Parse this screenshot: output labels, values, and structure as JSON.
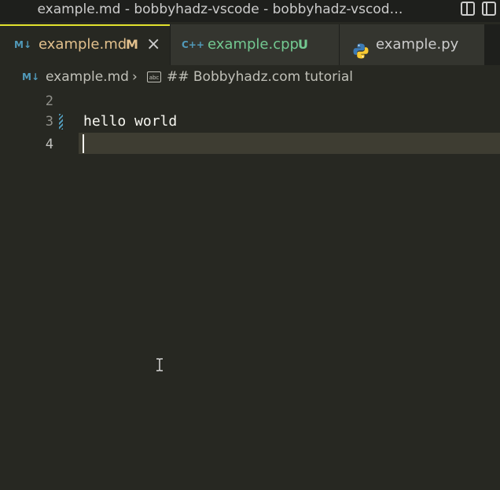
{
  "window": {
    "title": "example.md - bobbyhadz-vscode - bobbyhadz-vscod…"
  },
  "tabs": [
    {
      "icon_text": "M↓",
      "icon": "markdown-icon",
      "label": "example.md",
      "status": "M",
      "active": true,
      "label_color": "#e2c08d"
    },
    {
      "icon_text": "C++",
      "icon": "cpp-icon",
      "label": "example.cpp",
      "status": "U",
      "active": false,
      "label_color": "#73c991"
    },
    {
      "icon_text": "",
      "icon": "python-icon",
      "label": "example.py",
      "status": "",
      "active": false,
      "label_color": "#cccccc"
    }
  ],
  "breadcrumbs": {
    "file_icon_text": "M↓",
    "file": "example.md",
    "separator": "›",
    "symbol_icon_text": "abc",
    "symbol": "## Bobbyhadz.com tutorial"
  },
  "editor": {
    "lines": [
      {
        "number": "2",
        "text": ""
      },
      {
        "number": "3",
        "text": "hello world"
      },
      {
        "number": "4",
        "text": ""
      }
    ],
    "active_line": "4"
  },
  "colors": {
    "active_tab_border": "#e2e22e",
    "modified": "#e2c08d",
    "untracked": "#73c991",
    "markdown_icon": "#519aba",
    "cpp_icon": "#519aba"
  }
}
